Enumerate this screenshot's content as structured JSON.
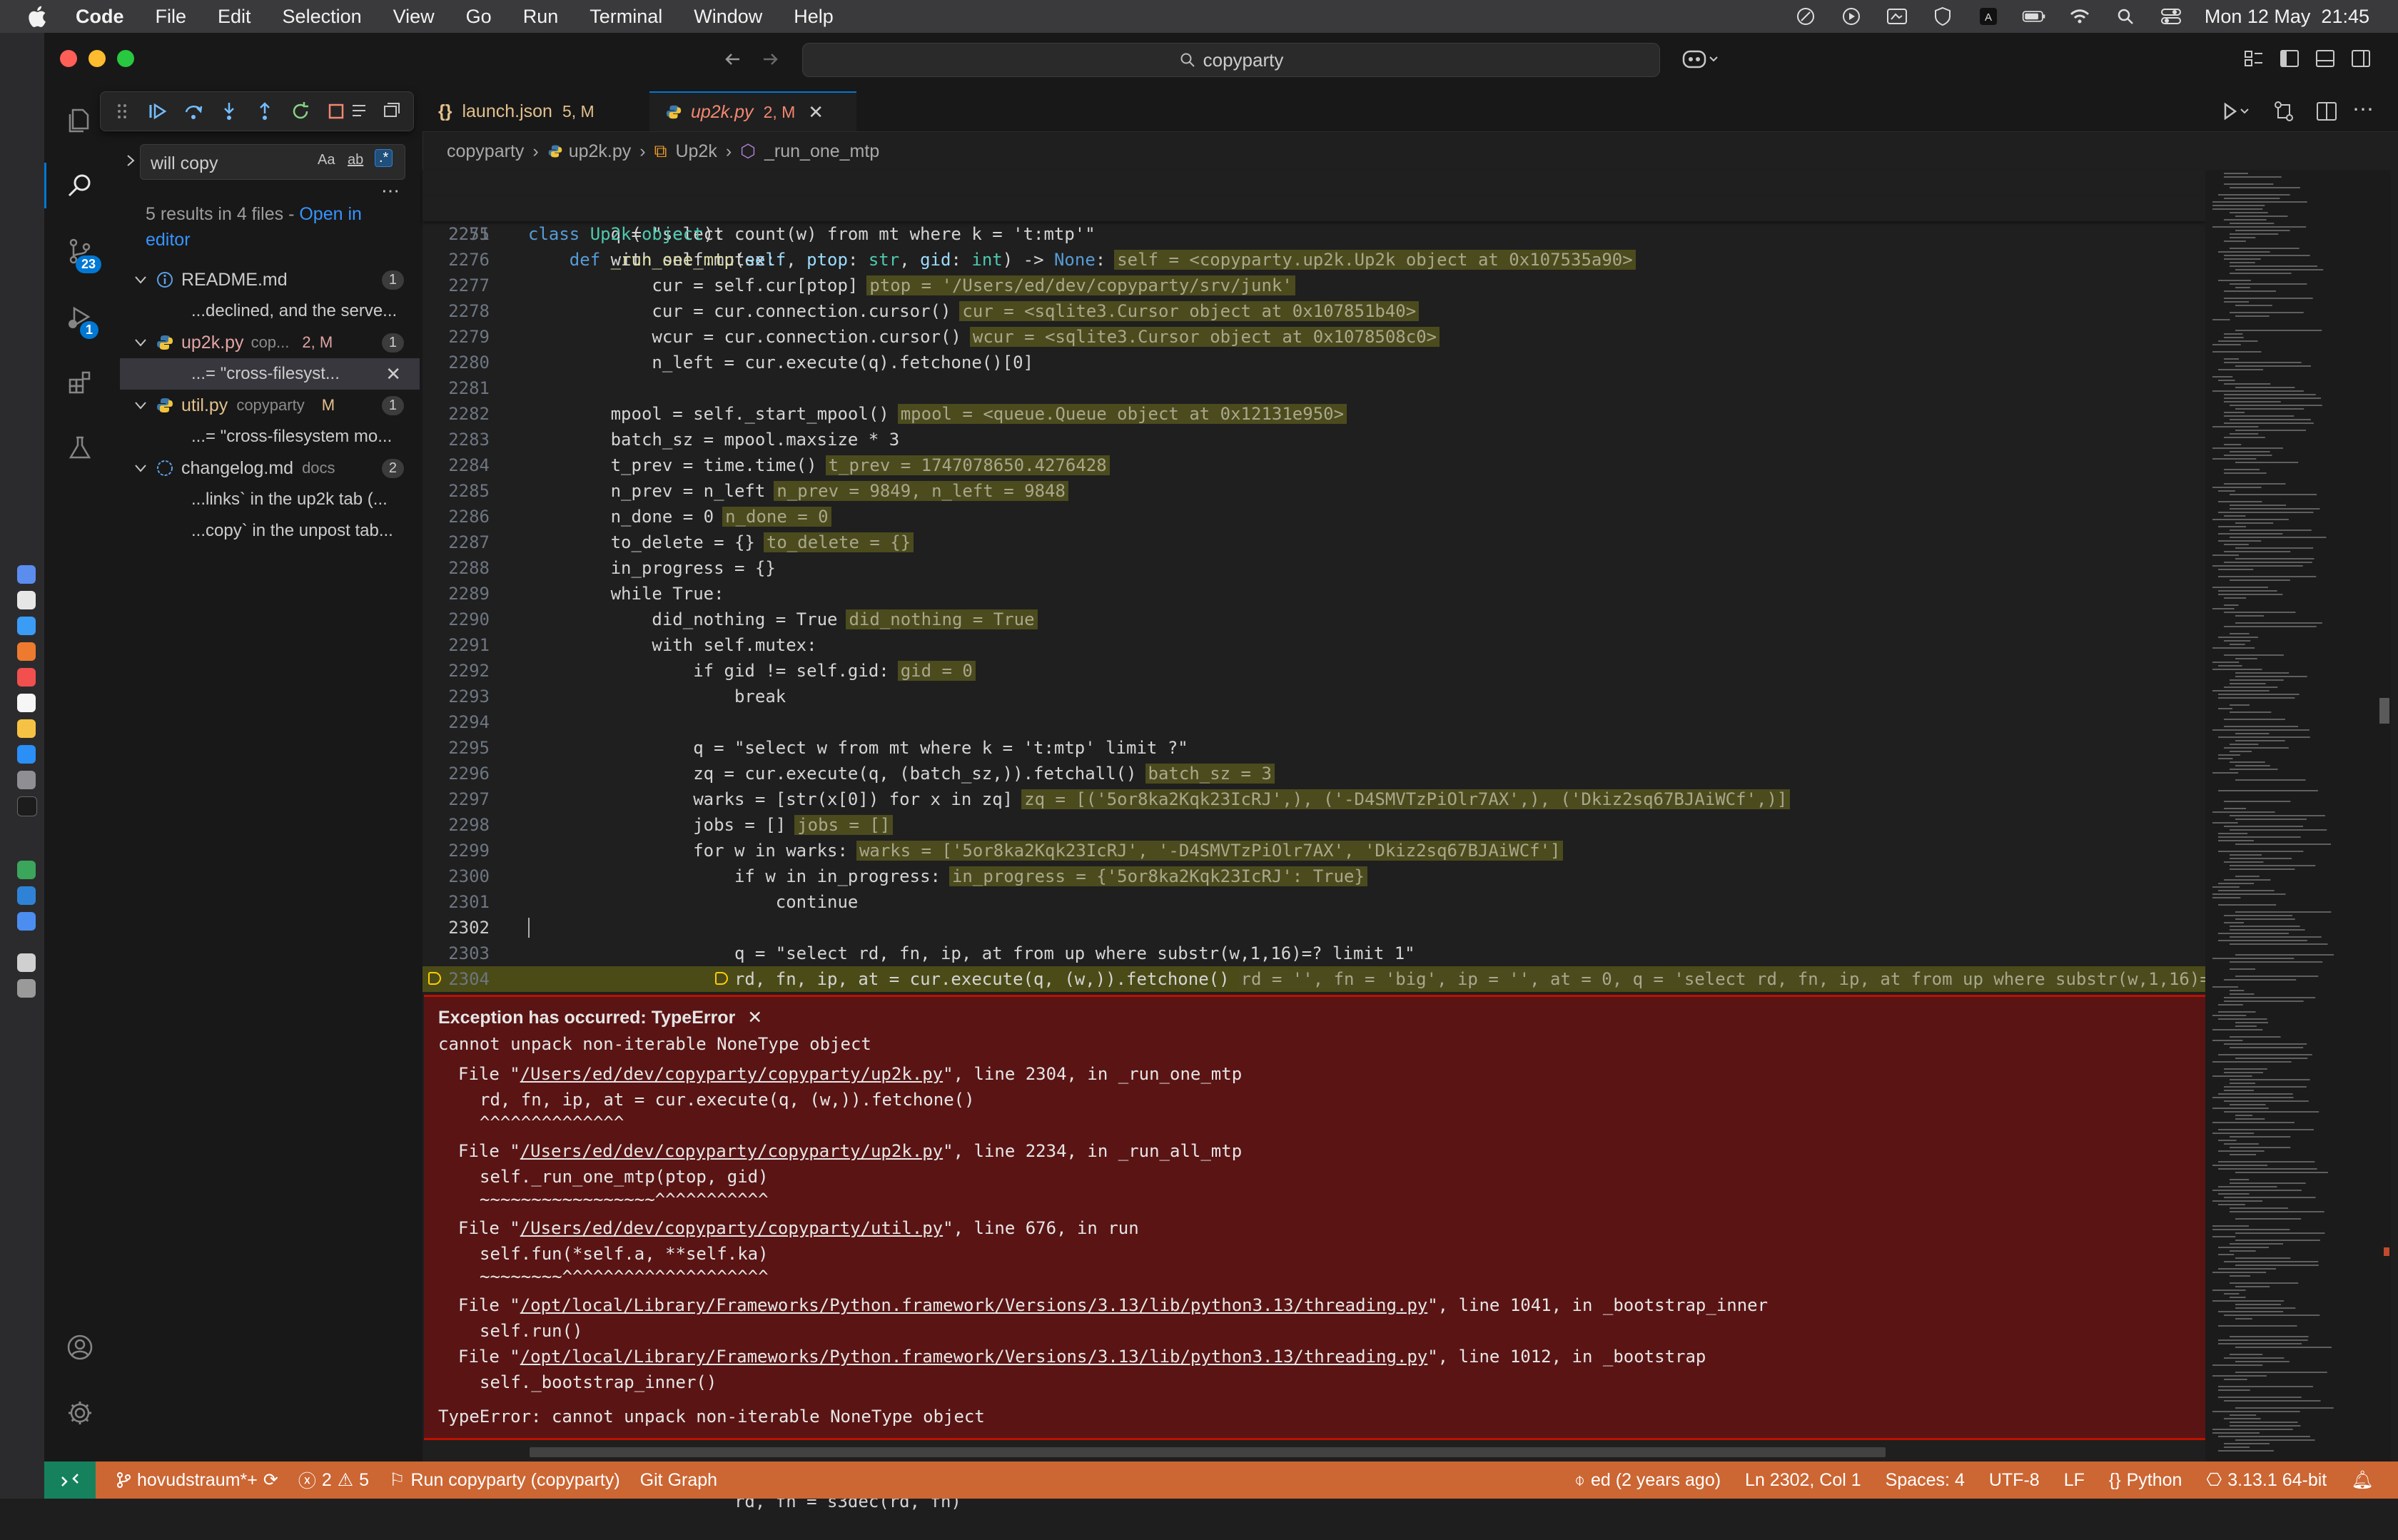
{
  "menubar": {
    "app": "Code",
    "items": [
      "File",
      "Edit",
      "Selection",
      "View",
      "Go",
      "Run",
      "Terminal",
      "Window",
      "Help"
    ],
    "clock": "Mon 12 May  21:45"
  },
  "titlebar": {
    "command_center": "copyparty"
  },
  "activity": {
    "scm_badge": "23",
    "debug_badge": "1"
  },
  "search": {
    "query": "will copy",
    "summary": "5 results in 4 files - ",
    "open_in_editor": "Open in editor",
    "opt_case": "Aa",
    "opt_word": "ab",
    "opt_regex": ".*",
    "results": [
      {
        "name": "README.md",
        "path": "",
        "status": "",
        "count": "1",
        "lines": [
          "...declined, and the serve..."
        ]
      },
      {
        "name": "up2k.py",
        "path": "cop...",
        "status": "2, M",
        "count": "1",
        "lines": [
          "...= \"cross-filesyst..."
        ]
      },
      {
        "name": "util.py",
        "path": "copyparty",
        "status": "M",
        "count": "1",
        "lines": [
          "...= \"cross-filesystem mo..."
        ]
      },
      {
        "name": "changelog.md",
        "path": "docs",
        "status": "",
        "count": "2",
        "lines": [
          "...links` in the up2k tab (...",
          "...copy` in the unpost tab..."
        ]
      }
    ]
  },
  "tabs": [
    {
      "icon": "{}",
      "label": "launch.json",
      "status": "5, M"
    },
    {
      "label": "up2k.py",
      "status": "2, M"
    }
  ],
  "breadcrumb": [
    "copyparty",
    "up2k.py",
    "Up2k",
    "_run_one_mtp"
  ],
  "code": {
    "sticky1_ln": "130",
    "sticky1": "class Up2k(object):",
    "sticky2_ln": "2251",
    "sticky2": "    def _run_one_mtp(self, ptop: str, gid: int) -> None:",
    "sticky2_inl": "self = <copyparty.up2k.Up2k object at 0x107535a90>",
    "lines": [
      {
        "n": "2275",
        "t": "        q = \"select count(w) from mt where k = 't:mtp'\"",
        "i": ""
      },
      {
        "n": "2276",
        "t": "        with self.mutex:",
        "i": ""
      },
      {
        "n": "2277",
        "t": "            cur = self.cur[ptop]",
        "i": "ptop = '/Users/ed/dev/copyparty/srv/junk'"
      },
      {
        "n": "2278",
        "t": "            cur = cur.connection.cursor()",
        "i": "cur = <sqlite3.Cursor object at 0x107851b40>"
      },
      {
        "n": "2279",
        "t": "            wcur = cur.connection.cursor()",
        "i": "wcur = <sqlite3.Cursor object at 0x1078508c0>"
      },
      {
        "n": "2280",
        "t": "            n_left = cur.execute(q).fetchone()[0]",
        "i": ""
      },
      {
        "n": "2281",
        "t": "",
        "i": ""
      },
      {
        "n": "2282",
        "t": "        mpool = self._start_mpool()",
        "i": "mpool = <queue.Queue object at 0x12131e950>"
      },
      {
        "n": "2283",
        "t": "        batch_sz = mpool.maxsize * 3",
        "i": ""
      },
      {
        "n": "2284",
        "t": "        t_prev = time.time()",
        "i": "t_prev = 1747078650.4276428"
      },
      {
        "n": "2285",
        "t": "        n_prev = n_left",
        "i": "n_prev = 9849, n_left = 9848"
      },
      {
        "n": "2286",
        "t": "        n_done = 0",
        "i": "n_done = 0"
      },
      {
        "n": "2287",
        "t": "        to_delete = {}",
        "i": "to_delete = {}"
      },
      {
        "n": "2288",
        "t": "        in_progress = {}",
        "i": ""
      },
      {
        "n": "2289",
        "t": "        while True:",
        "i": ""
      },
      {
        "n": "2290",
        "t": "            did_nothing = True",
        "i": "did_nothing = True"
      },
      {
        "n": "2291",
        "t": "            with self.mutex:",
        "i": ""
      },
      {
        "n": "2292",
        "t": "                if gid != self.gid:",
        "i": "gid = 0"
      },
      {
        "n": "2293",
        "t": "                    break",
        "i": ""
      },
      {
        "n": "2294",
        "t": "",
        "i": ""
      },
      {
        "n": "2295",
        "t": "                q = \"select w from mt where k = 't:mtp' limit ?\"",
        "i": ""
      },
      {
        "n": "2296",
        "t": "                zq = cur.execute(q, (batch_sz,)).fetchall()",
        "i": "batch_sz = 3"
      },
      {
        "n": "2297",
        "t": "                warks = [str(x[0]) for x in zq]",
        "i": "zq = [('5or8ka2Kqk23IcRJ',), ('-D4SMVTzPiOlr7AX',), ('Dkiz2sq67BJAiWCf',)]"
      },
      {
        "n": "2298",
        "t": "                jobs = []",
        "i": "jobs = []"
      },
      {
        "n": "2299",
        "t": "                for w in warks:",
        "i": "warks = ['5or8ka2Kqk23IcRJ', '-D4SMVTzPiOlr7AX', 'Dkiz2sq67BJAiWCf']"
      },
      {
        "n": "2300",
        "t": "                    if w in in_progress:",
        "i": "in_progress = {'5or8ka2Kqk23IcRJ': True}"
      },
      {
        "n": "2301",
        "t": "                        continue",
        "i": ""
      },
      {
        "n": "2302",
        "t": "",
        "i": ""
      },
      {
        "n": "2303",
        "t": "                    q = \"select rd, fn, ip, at from up where substr(w,1,16)=? limit 1\"",
        "i": ""
      },
      {
        "n": "2304",
        "t": "                    rd, fn, ip, at = cur.execute(q, (w,)).fetchone()",
        "i": "rd = '', fn = 'big', ip = '', at = 0, q = 'select rd, fn, ip, at from up where substr(w,1,16)="
      }
    ],
    "after_ln": "2305",
    "after": "                    rd, fn = s3dec(rd, fn)"
  },
  "exception": {
    "title": "Exception has occurred: TypeError",
    "message": "cannot unpack non-iterable NoneType object",
    "frames": [
      {
        "pre": "File \"",
        "path": "/Users/ed/dev/copyparty/copyparty/up2k.py",
        "post": "\", line 2304, in _run_one_mtp",
        "code": "rd, fn, ip, at = cur.execute(q, (w,)).fetchone()",
        "mark": "^^^^^^^^^^^^^^"
      },
      {
        "pre": "File \"",
        "path": "/Users/ed/dev/copyparty/copyparty/up2k.py",
        "post": "\", line 2234, in _run_all_mtp",
        "code": "self._run_one_mtp(ptop, gid)",
        "mark": "~~~~~~~~~~~~~~~~~^^^^^^^^^^^"
      },
      {
        "pre": "File \"",
        "path": "/Users/ed/dev/copyparty/copyparty/util.py",
        "post": "\", line 676, in run",
        "code": "self.fun(*self.a, **self.ka)",
        "mark": "~~~~~~~~^^^^^^^^^^^^^^^^^^^^"
      },
      {
        "pre": "File \"",
        "path": "/opt/local/Library/Frameworks/Python.framework/Versions/3.13/lib/python3.13/threading.py",
        "post": "\", line 1041, in _bootstrap_inner",
        "code": "self.run()",
        "mark": ""
      },
      {
        "pre": "File \"",
        "path": "/opt/local/Library/Frameworks/Python.framework/Versions/3.13/lib/python3.13/threading.py",
        "post": "\", line 1012, in _bootstrap",
        "code": "self._bootstrap_inner()",
        "mark": ""
      }
    ],
    "final": "TypeError: cannot unpack non-iterable NoneType object"
  },
  "statusbar": {
    "branch": "hovudstraum*+",
    "problems": "2",
    "warnings": "5",
    "run_config": "Run copyparty (copyparty)",
    "git_graph": "Git Graph",
    "blame": "ed (2 years ago)",
    "position": "Ln 2302, Col 1",
    "spaces": "Spaces: 4",
    "encoding": "UTF-8",
    "eol": "LF",
    "language": "Python",
    "interpreter": "3.13.1 64-bit"
  },
  "colors": {
    "accent": "#0078d4",
    "statusbar": "#cc6633",
    "exception_bg": "#5a1414",
    "exception_border": "#be1100",
    "current_line": "#4b4b18"
  }
}
